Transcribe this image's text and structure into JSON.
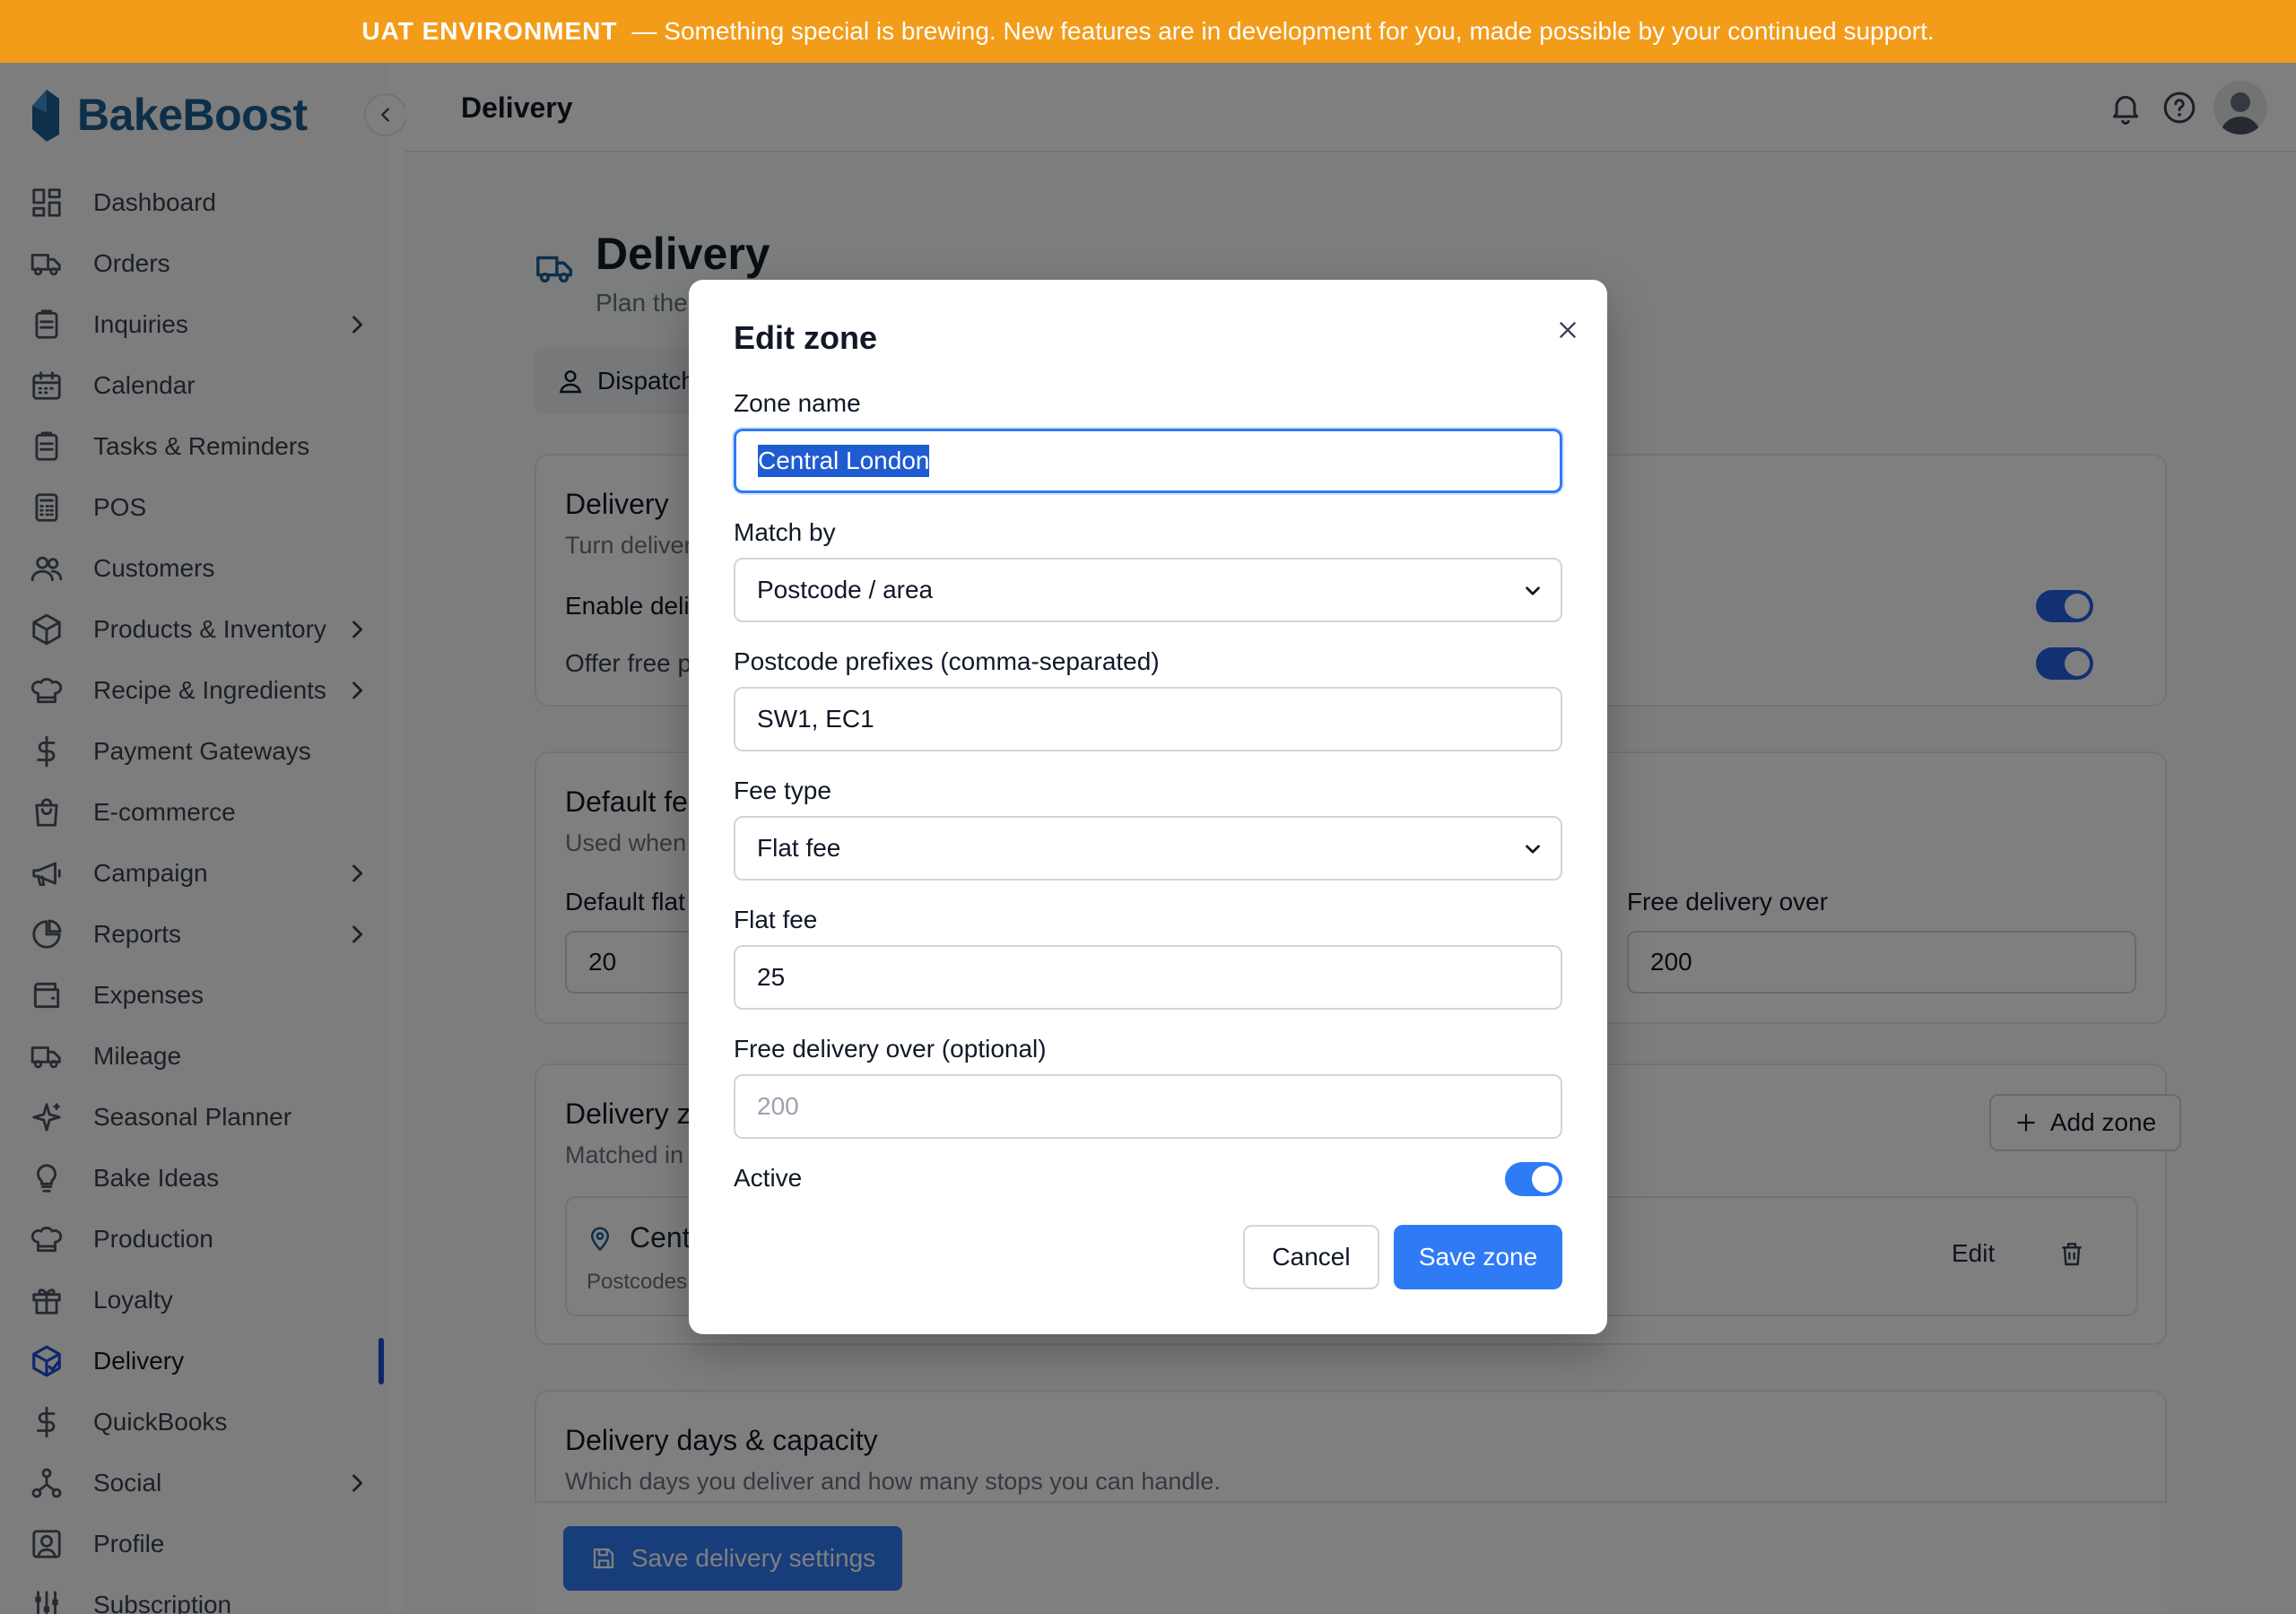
{
  "banner": {
    "label": "UAT ENVIRONMENT",
    "message": "— Something special is brewing. New features are in development for you, made possible by your continued support."
  },
  "brand": {
    "name": "BakeBoost",
    "color": "#1b5f93",
    "accent": "#2f7bf6",
    "banner_color": "#f39c1a"
  },
  "sidebar": {
    "items": [
      {
        "label": "Dashboard",
        "icon": "dashboard-icon",
        "chevron": false
      },
      {
        "label": "Orders",
        "icon": "truck-icon",
        "chevron": false
      },
      {
        "label": "Inquiries",
        "icon": "clipboard-icon",
        "chevron": true
      },
      {
        "label": "Calendar",
        "icon": "calendar-icon",
        "chevron": false
      },
      {
        "label": "Tasks & Reminders",
        "icon": "clipboard-icon",
        "chevron": false
      },
      {
        "label": "POS",
        "icon": "calculator-icon",
        "chevron": false
      },
      {
        "label": "Customers",
        "icon": "users-icon",
        "chevron": false
      },
      {
        "label": "Products & Inventory",
        "icon": "box-icon",
        "chevron": true
      },
      {
        "label": "Recipe & Ingredients",
        "icon": "chef-hat-icon",
        "chevron": true
      },
      {
        "label": "Payment Gateways",
        "icon": "dollar-icon",
        "chevron": false
      },
      {
        "label": "E-commerce",
        "icon": "shopping-bag-icon",
        "chevron": false
      },
      {
        "label": "Campaign",
        "icon": "megaphone-icon",
        "chevron": true
      },
      {
        "label": "Reports",
        "icon": "pie-chart-icon",
        "chevron": true
      },
      {
        "label": "Expenses",
        "icon": "wallet-icon",
        "chevron": false
      },
      {
        "label": "Mileage",
        "icon": "truck-icon",
        "chevron": false
      },
      {
        "label": "Seasonal Planner",
        "icon": "sparkle-icon",
        "chevron": false
      },
      {
        "label": "Bake Ideas",
        "icon": "lightbulb-icon",
        "chevron": false
      },
      {
        "label": "Production",
        "icon": "chef-hat-icon",
        "chevron": false
      },
      {
        "label": "Loyalty",
        "icon": "gift-icon",
        "chevron": false
      },
      {
        "label": "Delivery",
        "icon": "package-icon",
        "chevron": false,
        "active": true
      },
      {
        "label": "QuickBooks",
        "icon": "dollar-icon",
        "chevron": false
      },
      {
        "label": "Social",
        "icon": "share-icon",
        "chevron": true
      },
      {
        "label": "Profile",
        "icon": "profile-icon",
        "chevron": false
      },
      {
        "label": "Subscription",
        "icon": "sliders-icon",
        "chevron": false
      }
    ]
  },
  "header": {
    "title": "Delivery"
  },
  "page": {
    "title": "Delivery",
    "subtitle": "Plan the d",
    "tab": "Dispatch",
    "delivery_card": {
      "title": "Delivery",
      "desc": "Turn deliver",
      "enable_label": "Enable deliv",
      "free_label": "Offer free p"
    },
    "fee_card": {
      "title": "Default fe",
      "desc": "Used when",
      "flat_label": "Default flat",
      "flat_value": "20",
      "free_over_label": "Free delivery over",
      "free_over_value": "200"
    },
    "zones_card": {
      "title": "Delivery zo",
      "desc": "Matched in",
      "add_label": "Add zone",
      "zone_name": "Cent",
      "zone_postcodes": "Postcodes:",
      "edit_label": "Edit"
    },
    "days_card": {
      "title": "Delivery days & capacity",
      "desc": "Which days you deliver and how many stops you can handle."
    },
    "save_label": "Save delivery settings"
  },
  "modal": {
    "title": "Edit zone",
    "zone_name_label": "Zone name",
    "zone_name_value": "Central London",
    "match_by_label": "Match by",
    "match_by_value": "Postcode / area",
    "prefixes_label": "Postcode prefixes (comma-separated)",
    "prefixes_value": "SW1, EC1",
    "fee_type_label": "Fee type",
    "fee_type_value": "Flat fee",
    "flat_fee_label": "Flat fee",
    "flat_fee_value": "25",
    "free_over_label": "Free delivery over (optional)",
    "free_over_placeholder": "200",
    "active_label": "Active",
    "active": true,
    "cancel_label": "Cancel",
    "save_label": "Save zone"
  }
}
